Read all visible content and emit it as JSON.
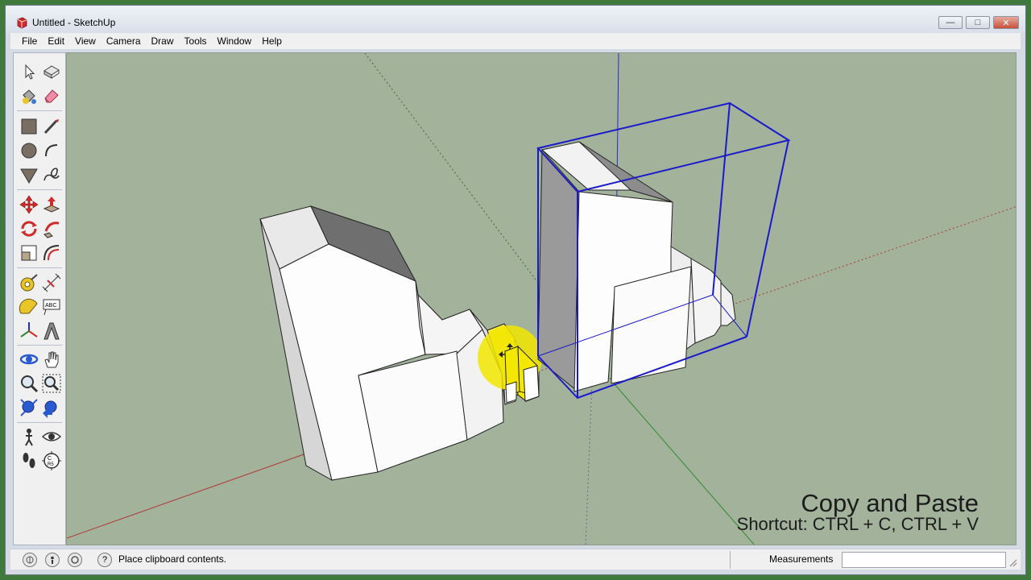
{
  "window": {
    "title": "Untitled - SketchUp",
    "minimize": "—",
    "maximize": "□",
    "close": "✕"
  },
  "menu": {
    "items": [
      "File",
      "Edit",
      "View",
      "Camera",
      "Draw",
      "Tools",
      "Window",
      "Help"
    ]
  },
  "toolbar": {
    "tools": [
      {
        "name": "select-tool-icon"
      },
      {
        "name": "make-component-icon"
      },
      {
        "name": "paint-bucket-icon"
      },
      {
        "name": "eraser-icon"
      },
      {
        "name": "rectangle-tool-icon"
      },
      {
        "name": "line-tool-icon"
      },
      {
        "name": "circle-tool-icon"
      },
      {
        "name": "arc-tool-icon"
      },
      {
        "name": "polygon-tool-icon"
      },
      {
        "name": "freehand-tool-icon"
      },
      {
        "name": "move-tool-icon"
      },
      {
        "name": "push-pull-tool-icon"
      },
      {
        "name": "rotate-tool-icon"
      },
      {
        "name": "follow-me-tool-icon"
      },
      {
        "name": "scale-tool-icon"
      },
      {
        "name": "offset-tool-icon"
      },
      {
        "name": "tape-measure-icon"
      },
      {
        "name": "dimension-tool-icon"
      },
      {
        "name": "protractor-icon"
      },
      {
        "name": "text-tool-icon"
      },
      {
        "name": "axes-tool-icon"
      },
      {
        "name": "3d-text-icon"
      },
      {
        "name": "orbit-tool-icon"
      },
      {
        "name": "pan-tool-icon"
      },
      {
        "name": "zoom-tool-icon"
      },
      {
        "name": "zoom-window-icon"
      },
      {
        "name": "zoom-extents-icon"
      },
      {
        "name": "previous-view-icon"
      },
      {
        "name": "position-camera-icon"
      },
      {
        "name": "look-around-icon"
      },
      {
        "name": "walk-tool-icon"
      },
      {
        "name": "section-plane-icon"
      }
    ]
  },
  "overlay": {
    "title": "Copy and Paste",
    "shortcut": "Shortcut: CTRL + C, CTRL + V"
  },
  "status": {
    "message": "Place clipboard contents.",
    "help_glyph": "?",
    "measurements_label": "Measurements",
    "measurements_value": ""
  },
  "colors": {
    "viewport_bg": "#a2b29b",
    "selection_box": "#1a1acc",
    "red_axis": "#b03a3a",
    "green_axis": "#2f8a2f",
    "blue_axis": "#2a2ad0",
    "highlight": "#f2e600"
  }
}
